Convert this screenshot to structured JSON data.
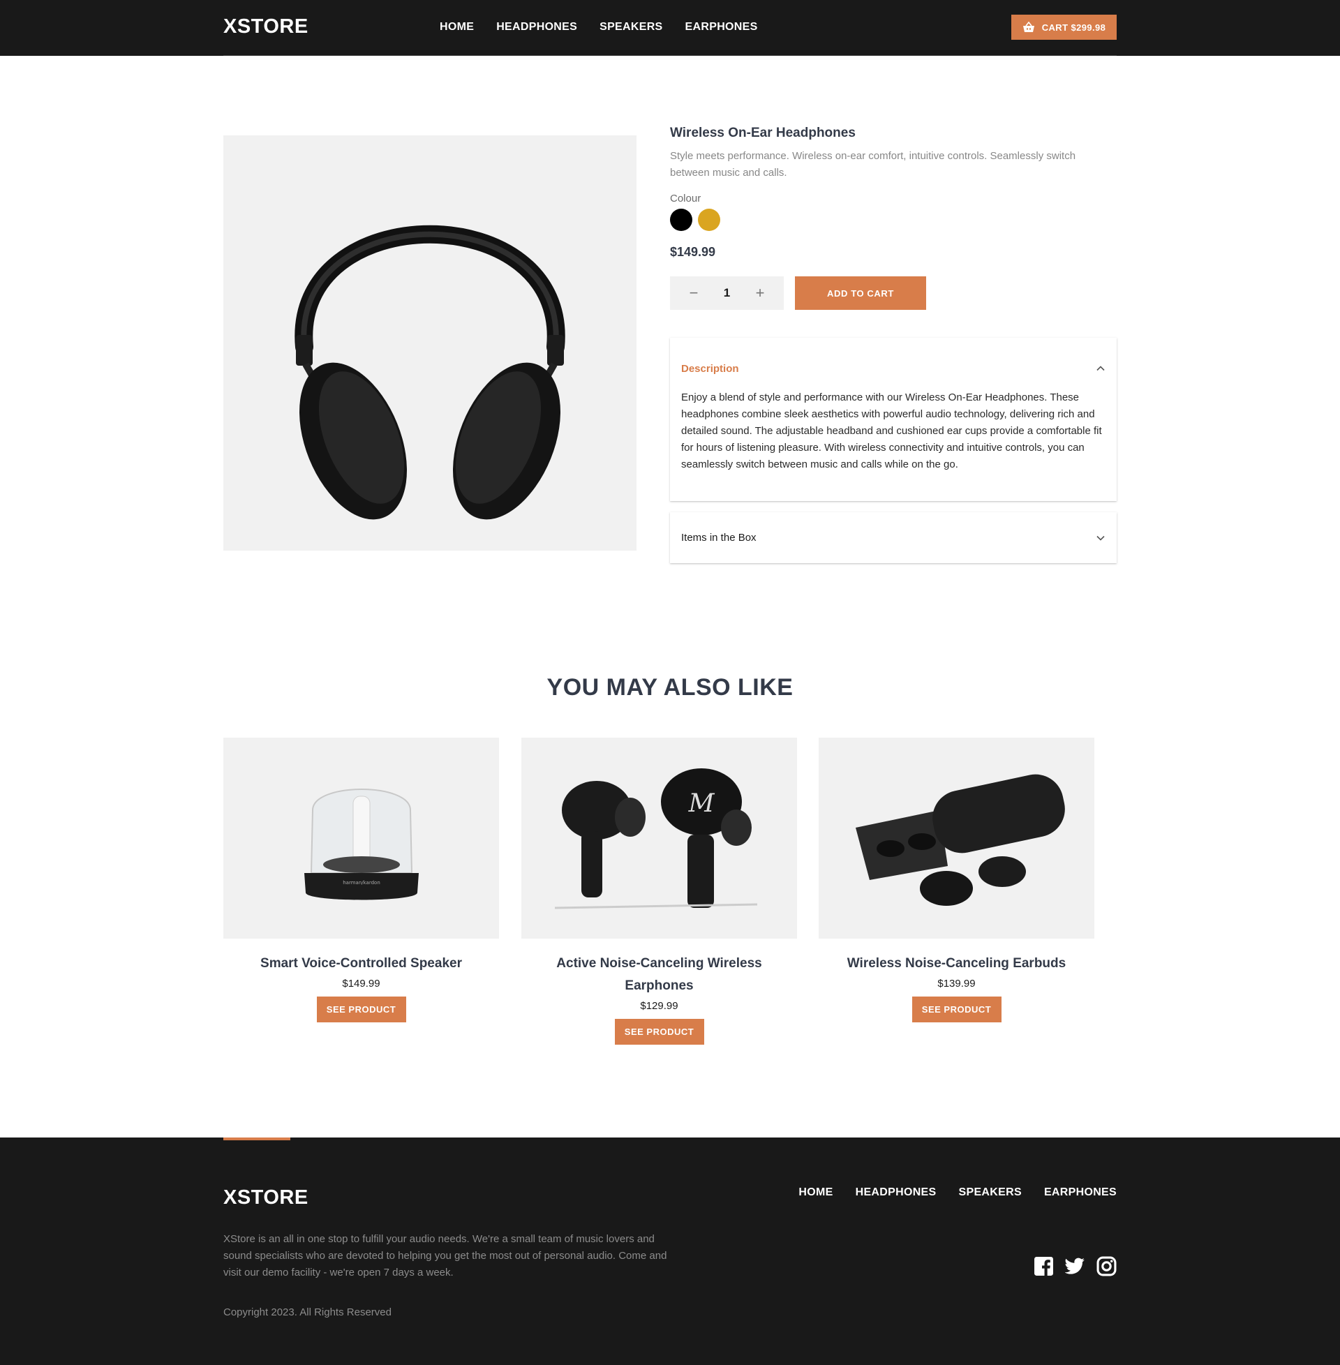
{
  "header": {
    "logo": "XSTORE",
    "nav": [
      "HOME",
      "HEADPHONES",
      "SPEAKERS",
      "EARPHONES"
    ],
    "cart_label": "CART $299.98",
    "cart_icon": "basket-icon"
  },
  "product": {
    "title": "Wireless On-Ear Headphones",
    "subtitle": "Style meets performance. Wireless on-ear comfort, intuitive controls. Seamlessly switch between music and calls.",
    "colour_label": "Colour",
    "colours": [
      "#000000",
      "#daa520"
    ],
    "price": "$149.99",
    "quantity": "1",
    "add_to_cart": "ADD TO CART",
    "image_icon": "headphones-image"
  },
  "accordion": {
    "description_title": "Description",
    "description_text": "Enjoy a blend of style and performance with our Wireless On-Ear Headphones. These headphones combine sleek aesthetics with powerful audio technology, delivering rich and detailed sound. The adjustable headband and cushioned ear cups provide a comfortable fit for hours of listening pleasure. With wireless connectivity and intuitive controls, you can seamlessly switch between music and calls while on the go.",
    "items_title": "Items in the Box"
  },
  "related": {
    "title": "YOU MAY ALSO LIKE",
    "items": [
      {
        "name": "Smart Voice-Controlled Speaker",
        "price": "$149.99",
        "button": "SEE PRODUCT"
      },
      {
        "name": "Active Noise-Canceling Wireless Earphones",
        "price": "$129.99",
        "button": "SEE PRODUCT"
      },
      {
        "name": "Wireless Noise-Canceling Earbuds",
        "price": "$139.99",
        "button": "SEE PRODUCT"
      }
    ]
  },
  "footer": {
    "logo": "XSTORE",
    "nav": [
      "HOME",
      "HEADPHONES",
      "SPEAKERS",
      "EARPHONES"
    ],
    "about": "XStore is an all in one stop to fulfill your audio needs. We're a small team of music lovers and sound specialists who are devoted to helping you get the most out of personal audio. Come and visit our demo facility - we're open 7 days a week.",
    "copyright": "Copyright 2023. All Rights Reserved",
    "social": [
      "facebook-icon",
      "twitter-icon",
      "instagram-icon"
    ]
  },
  "colors": {
    "accent": "#d87d4a",
    "dark": "#191919",
    "heading": "#333a48"
  }
}
